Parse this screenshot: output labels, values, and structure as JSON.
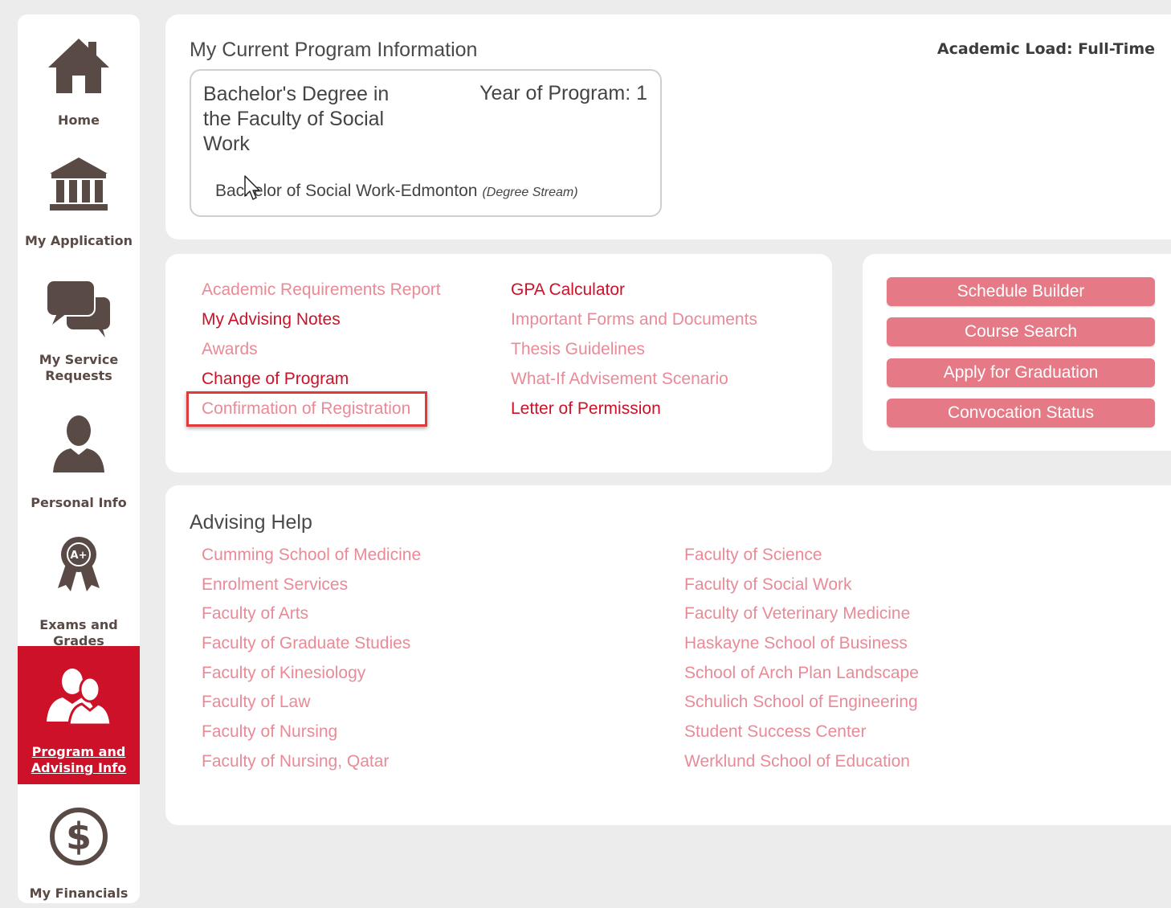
{
  "sidebar": {
    "items": [
      {
        "label": "Home",
        "icon": "home-icon"
      },
      {
        "label": "My Application",
        "icon": "institution-icon"
      },
      {
        "label": "My Service Requests",
        "icon": "chat-bubbles-icon"
      },
      {
        "label": "Personal Info",
        "icon": "person-icon"
      },
      {
        "label": "Exams and Grades",
        "icon": "award-badge-icon"
      },
      {
        "label": "Program and Advising Info",
        "icon": "people-icon",
        "active": true
      },
      {
        "label": "My Financials",
        "icon": "dollar-icon"
      }
    ]
  },
  "program": {
    "title": "My Current Program Information",
    "academic_load": "Academic Load: Full-Time",
    "degree": "Bachelor's Degree in the Faculty of Social Work",
    "year": "Year of Program: 1",
    "stream": "Bachelor of Social Work-Edmonton",
    "stream_tag": "(Degree Stream)"
  },
  "links": {
    "left": [
      {
        "label": "Academic Requirements Report",
        "style": "light"
      },
      {
        "label": "My Advising Notes",
        "style": "dark"
      },
      {
        "label": "Awards",
        "style": "light"
      },
      {
        "label": "Change of Program",
        "style": "dark"
      },
      {
        "label": "Confirmation of Registration",
        "style": "light",
        "highlighted": true
      }
    ],
    "right": [
      {
        "label": "GPA Calculator",
        "style": "dark"
      },
      {
        "label": "Important Forms and Documents",
        "style": "light"
      },
      {
        "label": "Thesis Guidelines",
        "style": "light"
      },
      {
        "label": "What-If Advisement Scenario",
        "style": "light"
      },
      {
        "label": "Letter of Permission",
        "style": "dark"
      }
    ]
  },
  "buttons": [
    "Schedule Builder",
    "Course Search",
    "Apply for Graduation",
    "Convocation Status"
  ],
  "advising": {
    "title": "Advising Help",
    "left": [
      "Cumming School of Medicine",
      "Enrolment Services",
      "Faculty of Arts",
      "Faculty of Graduate Studies",
      "Faculty of Kinesiology",
      "Faculty of Law",
      "Faculty of Nursing",
      "Faculty of Nursing, Qatar"
    ],
    "right": [
      "Faculty of Science",
      "Faculty of Social Work",
      "Faculty of Veterinary Medicine",
      "Haskayne School of Business",
      "School of Arch Plan Landscape",
      "Schulich School of Engineering",
      "Student Success Center",
      "Werklund School of Education"
    ]
  },
  "colors": {
    "accent": "#cc1128",
    "link_light": "#e98a97",
    "button": "#e57a86",
    "icon": "#5a4a45"
  }
}
